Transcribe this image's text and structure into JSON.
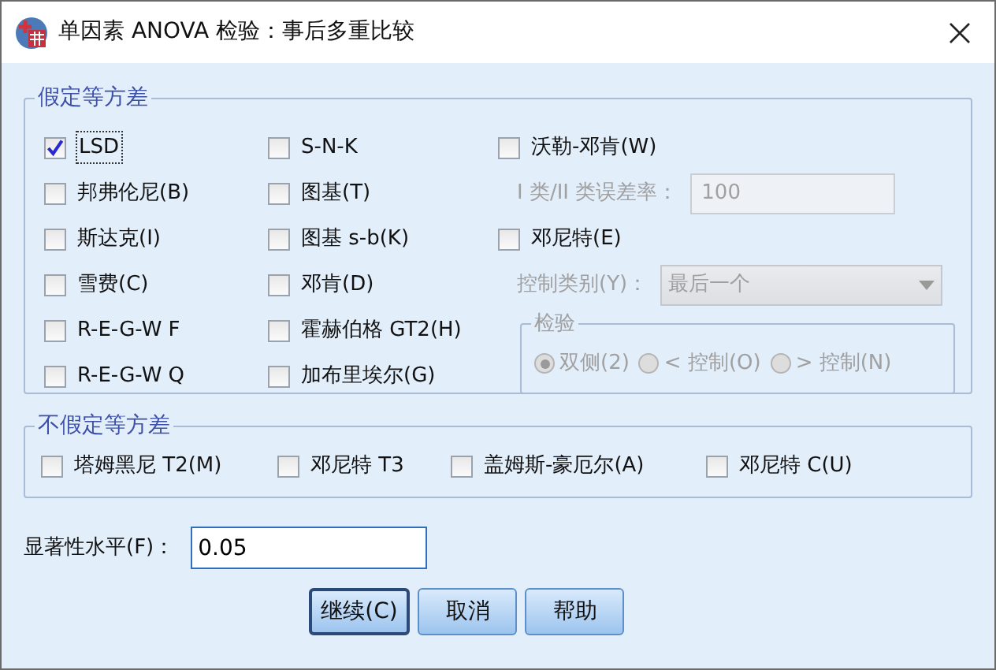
{
  "window": {
    "title": "单因素 ANOVA 检验：事后多重比较"
  },
  "equal_variances": {
    "title": "假定等方差",
    "column_1": [
      {
        "label": "LSD",
        "checked": true,
        "focused": true
      },
      {
        "label": "邦弗伦尼(B)",
        "checked": false
      },
      {
        "label": "斯达克(I)",
        "checked": false
      },
      {
        "label": "雪费(C)",
        "checked": false
      },
      {
        "label": "R-E-G-W F",
        "checked": false
      },
      {
        "label": "R-E-G-W Q",
        "checked": false
      }
    ],
    "column_2": [
      {
        "label": "S-N-K",
        "checked": false
      },
      {
        "label": "图基(T)",
        "checked": false
      },
      {
        "label": "图基 s-b(K)",
        "checked": false
      },
      {
        "label": "邓肯(D)",
        "checked": false
      },
      {
        "label": "霍赫伯格 GT2(H)",
        "checked": false
      },
      {
        "label": "加布里埃尔(G)",
        "checked": false
      }
    ],
    "waller": {
      "label": "沃勒-邓肯(W)",
      "checked": false,
      "ratio_label": "I 类/II 类误差率：",
      "ratio_value": "100",
      "disabled": true
    },
    "dunnett": {
      "label": "邓尼特(E)",
      "checked": false,
      "control_label": "控制类别(Y)：",
      "control_value": "最后一个",
      "disabled": true,
      "test": {
        "title": "检验",
        "options": [
          {
            "label": "双侧(2)",
            "selected": true
          },
          {
            "label": "< 控制(O)",
            "selected": false
          },
          {
            "label": "> 控制(N)",
            "selected": false
          }
        ]
      }
    }
  },
  "unequal_variances": {
    "title": "不假定等方差",
    "options": [
      {
        "label": "塔姆黑尼 T2(M)",
        "checked": false
      },
      {
        "label": "邓尼特 T3",
        "checked": false
      },
      {
        "label": "盖姆斯-豪厄尔(A)",
        "checked": false
      },
      {
        "label": "邓尼特 C(U)",
        "checked": false
      }
    ]
  },
  "significance": {
    "label": "显著性水平(F)：",
    "value": "0.05"
  },
  "buttons": [
    {
      "label": "继续(C)",
      "default": true
    },
    {
      "label": "取消",
      "default": false
    },
    {
      "label": "帮助",
      "default": false
    }
  ]
}
